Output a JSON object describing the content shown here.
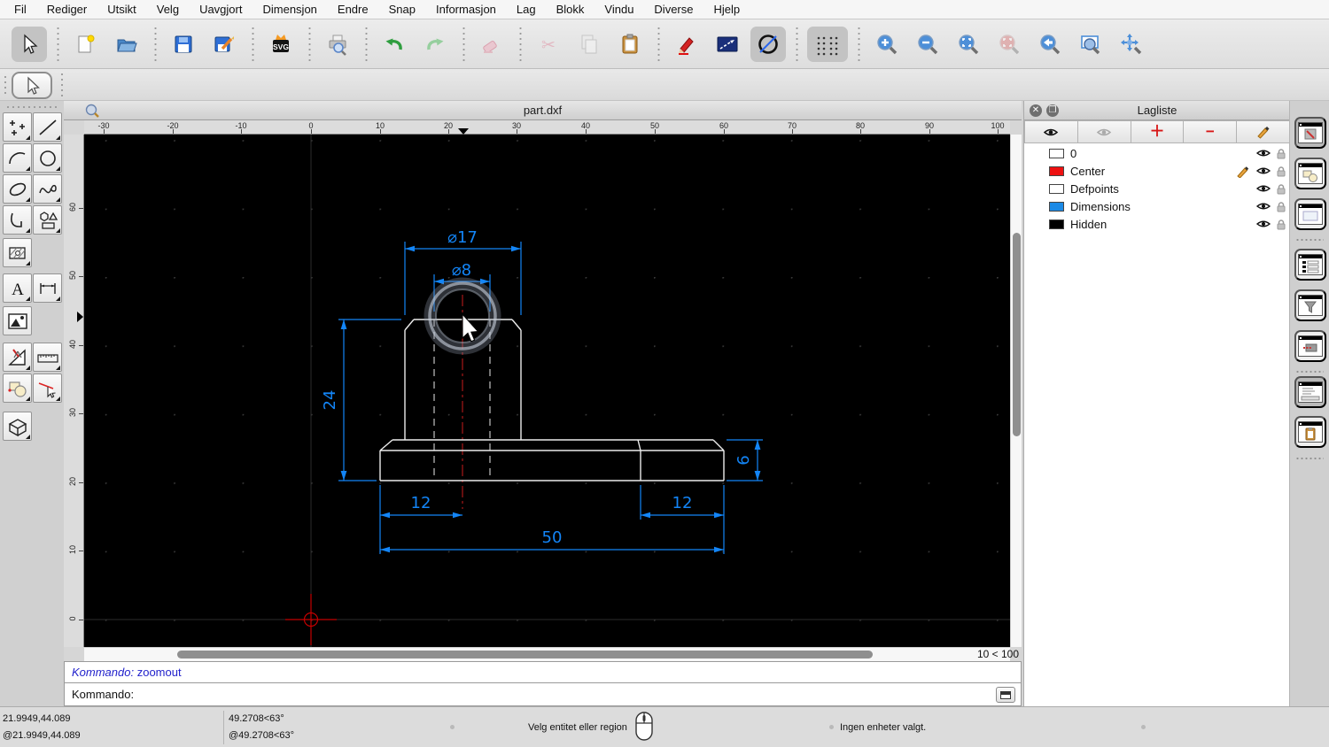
{
  "menubar": {
    "items": [
      "Fil",
      "Rediger",
      "Utsikt",
      "Velg",
      "Uavgjort",
      "Dimensjon",
      "Endre",
      "Snap",
      "Informasjon",
      "Lag",
      "Blokk",
      "Vindu",
      "Diverse",
      "Hjelp"
    ]
  },
  "main_toolbar": {
    "tools": [
      "select-arrow",
      "new-document",
      "open-file",
      "save",
      "save-as",
      "export-svg",
      "print-preview",
      "undo",
      "redo",
      "erase",
      "cut",
      "copy",
      "paste",
      "draw-pencil",
      "line-settings",
      "circle-tool",
      "grid-toggle",
      "zoom-in",
      "zoom-out",
      "zoom-auto",
      "zoom-selection",
      "zoom-previous",
      "zoom-window",
      "zoom-pan"
    ],
    "selected": [
      "select-arrow",
      "circle-tool",
      "grid-toggle"
    ],
    "disabled": [
      "erase",
      "cut",
      "copy",
      "zoom-selection"
    ]
  },
  "tool_palette": {
    "tools": [
      "points",
      "line",
      "arc",
      "circle",
      "ellipse",
      "spline",
      "polyline",
      "polygon",
      "hatch",
      "text",
      "dimension",
      "image",
      "measure",
      "ruler",
      "block",
      "select-entity",
      "solid-3d"
    ]
  },
  "document": {
    "title": "part.dxf"
  },
  "rulers": {
    "h": [
      "-30",
      "-20",
      "-10",
      "0",
      "10",
      "20",
      "30",
      "40",
      "50",
      "60",
      "70",
      "80",
      "90",
      "100"
    ],
    "v": [
      "60",
      "50",
      "40",
      "30",
      "20",
      "10",
      "0"
    ]
  },
  "drawing": {
    "dimensions": {
      "dia17": "⌀17",
      "dia8": "⌀8",
      "height24": "24",
      "left12": "12",
      "right12": "12",
      "width50": "50",
      "height6": "6"
    },
    "colors": {
      "dimension": "#1385f7",
      "geometry": "#ececec",
      "hidden": "#b4b4b4",
      "centerline": "#991515",
      "canvas": "#000000",
      "origin_marker": "#c40000"
    }
  },
  "viewport": {
    "zoom_label": "10 < 100"
  },
  "command": {
    "history_label": "Kommando:",
    "history_value": "zoomout",
    "prompt": "Kommando:"
  },
  "layer_panel": {
    "title": "Lagliste",
    "toolbar": [
      "show-all-layers",
      "hide-all-layers",
      "add-layer",
      "remove-layer",
      "edit-layer"
    ],
    "layers": [
      {
        "name": "0",
        "color": "#ffffff",
        "visible": true,
        "locked": false
      },
      {
        "name": "Center",
        "color": "#ee1111",
        "visible": true,
        "locked": false,
        "editing": true
      },
      {
        "name": "Defpoints",
        "color": "#ffffff",
        "visible": true,
        "locked": false
      },
      {
        "name": "Dimensions",
        "color": "#1b8ae6",
        "visible": true,
        "locked": false
      },
      {
        "name": "Hidden",
        "color": "#000000",
        "visible": true,
        "locked": false
      }
    ]
  },
  "dock_strip": {
    "items": [
      "layer-list",
      "block-list",
      "library-browser",
      "entity-list",
      "selection-filter",
      "pen-panel",
      "command-line",
      "clipboard-panel"
    ],
    "active": [
      "layer-list",
      "command-line"
    ]
  },
  "statusbar": {
    "abs_coord": "21.9949,44.089",
    "rel_coord": "@21.9949,44.089",
    "abs_polar": "49.2708<63°",
    "rel_polar": "@49.2708<63°",
    "hint": "Velg entitet eller region",
    "selection_info": "Ingen enheter valgt."
  }
}
